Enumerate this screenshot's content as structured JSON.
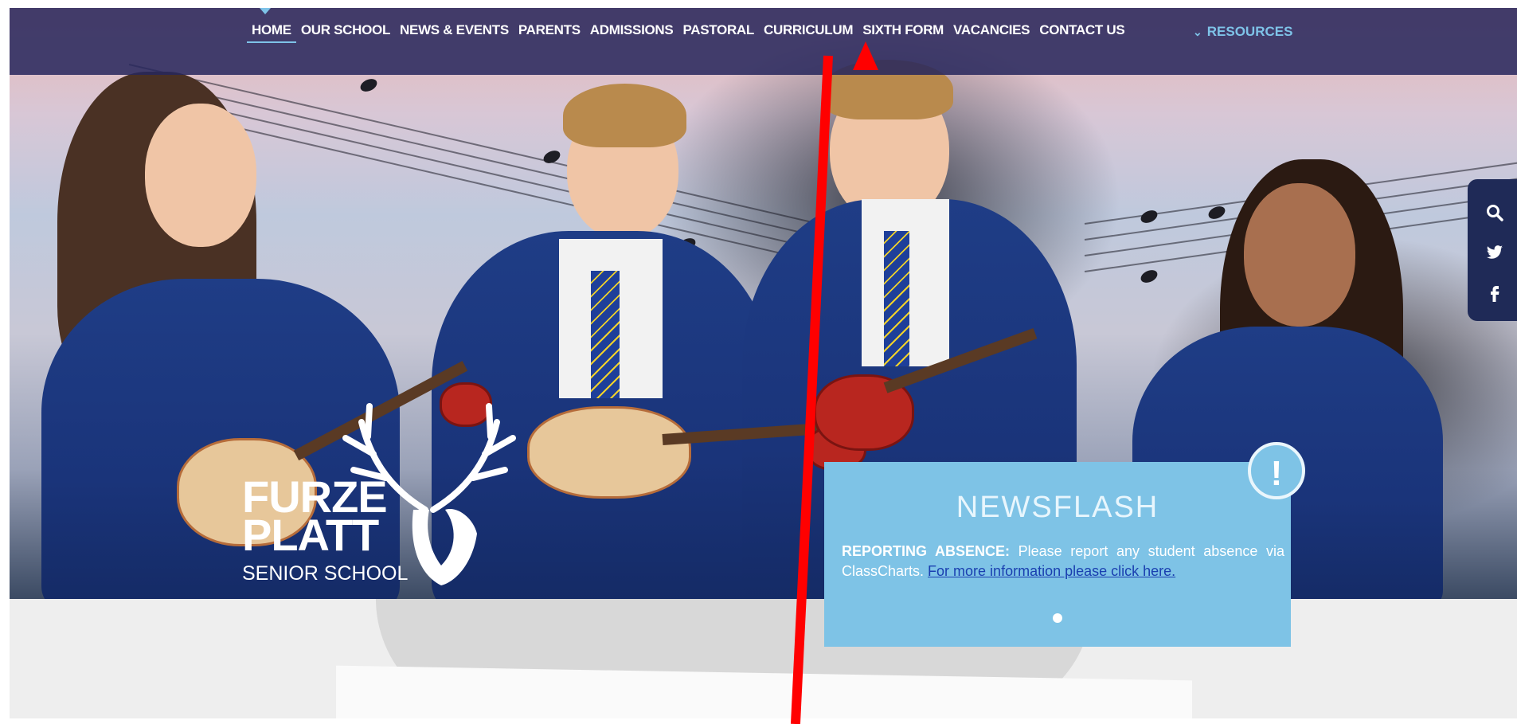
{
  "nav": {
    "items": [
      {
        "label": "HOME",
        "active": true
      },
      {
        "label": "OUR SCHOOL",
        "active": false
      },
      {
        "label": "NEWS & EVENTS",
        "active": false
      },
      {
        "label": "PARENTS",
        "active": false
      },
      {
        "label": "ADMISSIONS",
        "active": false
      },
      {
        "label": "PASTORAL",
        "active": false
      },
      {
        "label": "CURRICULUM",
        "active": false
      },
      {
        "label": "SIXTH FORM",
        "active": false
      },
      {
        "label": "VACANCIES",
        "active": false
      },
      {
        "label": "CONTACT US",
        "active": false
      }
    ],
    "resources_label": "RESOURCES",
    "resources_icon": "chevron-down-icon",
    "accent_color": "#7ec3e8"
  },
  "logo": {
    "line1": "FURZE",
    "line2": "PLATT",
    "subtitle": "SENIOR SCHOOL",
    "icon": "stag-icon"
  },
  "social": {
    "icons": [
      "search-icon",
      "twitter-icon",
      "facebook-icon"
    ]
  },
  "newsflash": {
    "title": "NEWSFLASH",
    "badge": "!",
    "bold_prefix": "REPORTING ABSENCE:",
    "body": "Please report any student absence via ClassCharts.",
    "link_text": "For more information please click here.",
    "color": "#7ec3e6"
  },
  "annotation": {
    "type": "red-arrow",
    "target": "SIXTH FORM",
    "color": "#ff0000"
  }
}
